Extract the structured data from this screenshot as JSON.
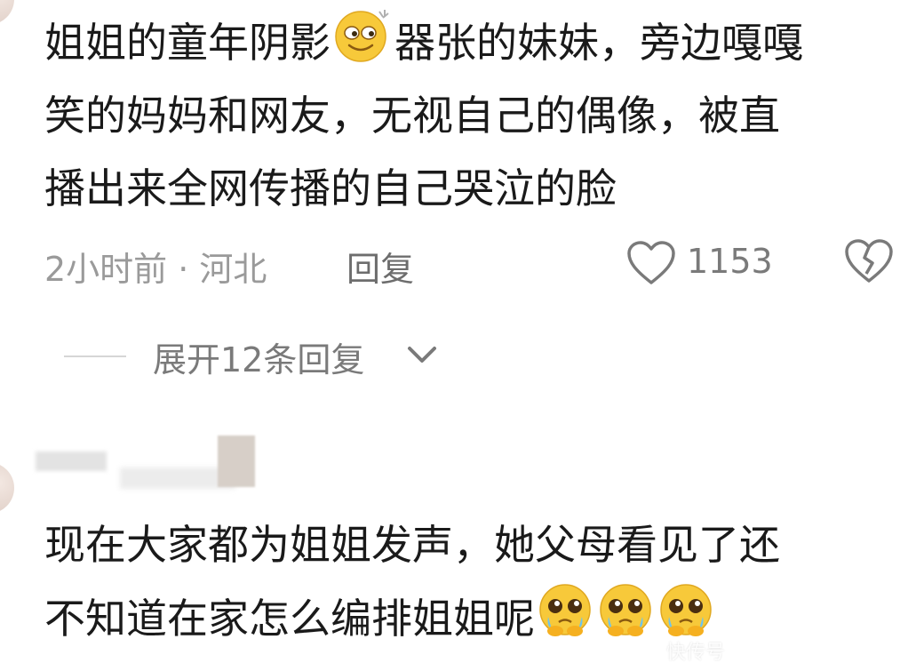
{
  "comment1": {
    "lines": [
      [
        "姐姐的童年阴影",
        "器张的妹妹，旁边嘎嘎"
      ],
      "笑的妈妈和网友，无视自己的偶像，被直",
      "播出来全网传播的自己哭泣的脸"
    ],
    "emoji_icon": "smirk-face-icon",
    "time_location": "2小时前 · 河北",
    "reply_label": "回复",
    "like_count": "1153",
    "like_icon": "heart-outline-icon",
    "dislike_icon": "broken-heart-icon"
  },
  "replies": {
    "expand_label": "展开12条回复",
    "chevron_icon": "chevron-down-icon"
  },
  "comment2": {
    "lines": [
      "现在大家都为姐姐发声，她父母看见了还",
      "不知道在家怎么编排姐姐呢"
    ],
    "emoji_icon": "pleading-face-icon",
    "emoji_count": 3
  },
  "watermark": "快传号",
  "colors": {
    "text": "#1a1a1a",
    "meta": "#9a9a9a",
    "emoji_yellow": "#f7c93a"
  }
}
